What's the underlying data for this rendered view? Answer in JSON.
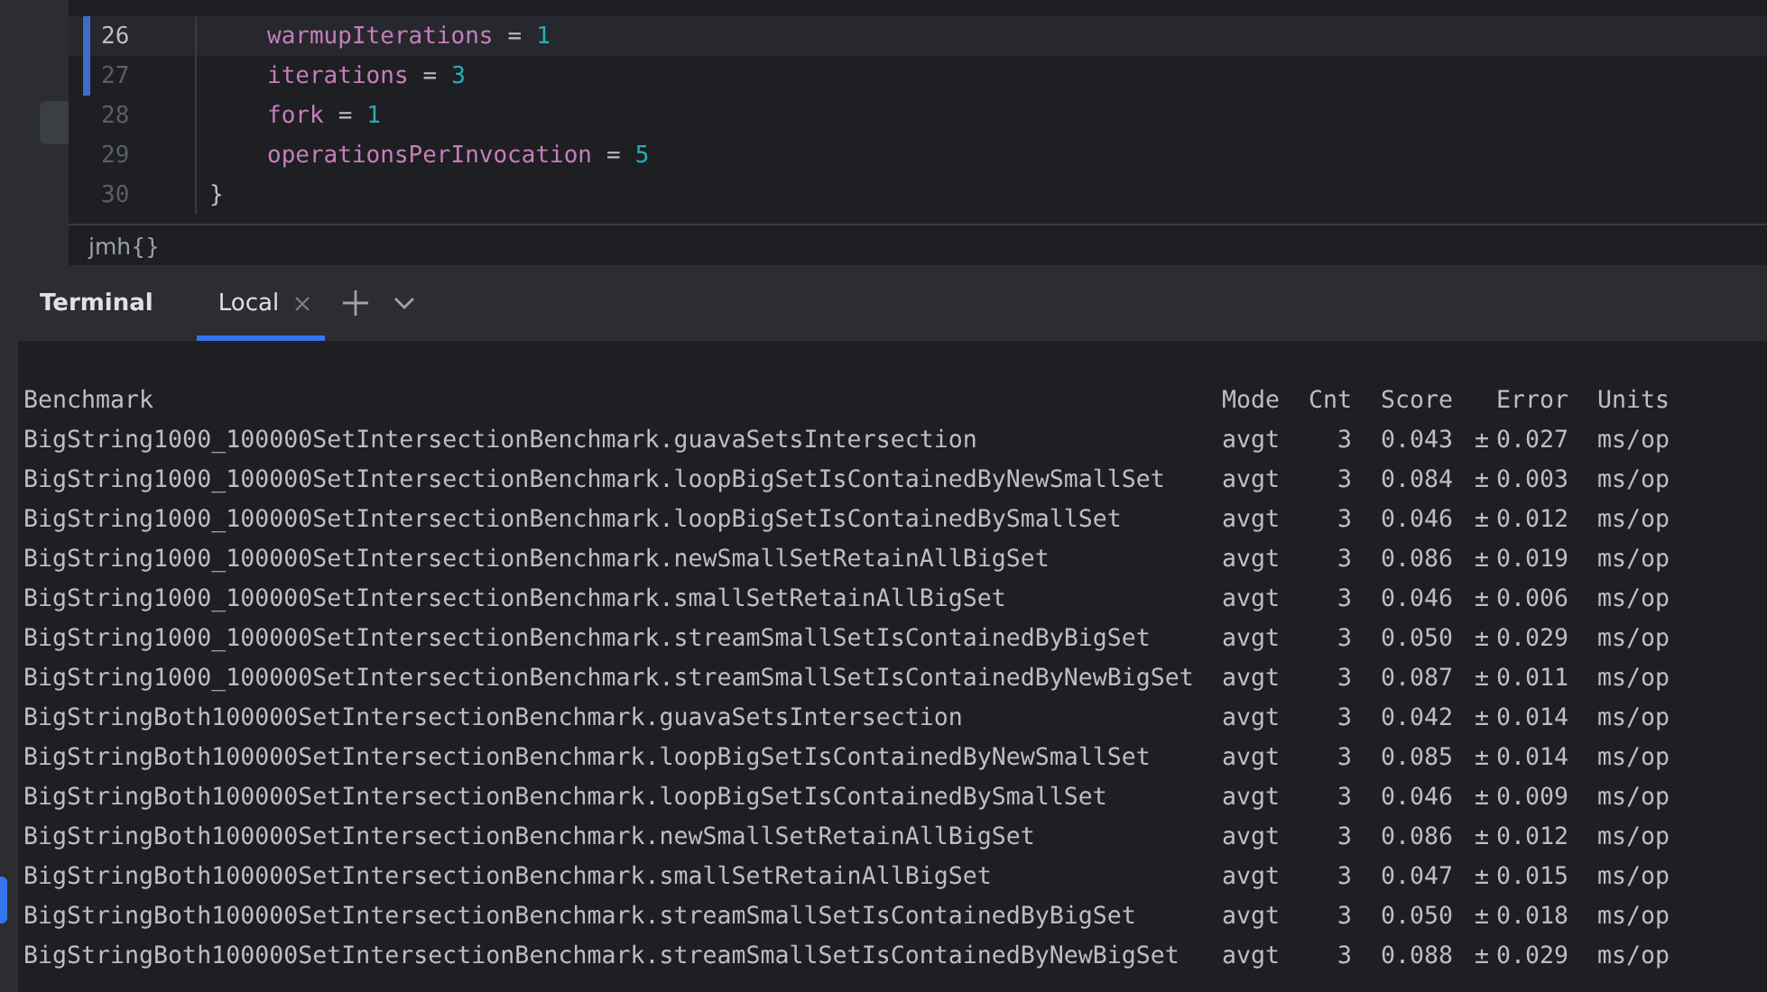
{
  "editor": {
    "lines": [
      {
        "number": "26",
        "current": true,
        "changed": true,
        "indented": true,
        "tokens": [
          {
            "kind": "property",
            "text": "warmupIterations"
          },
          {
            "kind": "operator",
            "text": "="
          },
          {
            "kind": "number",
            "text": "1"
          }
        ]
      },
      {
        "number": "27",
        "current": false,
        "changed": true,
        "indented": true,
        "tokens": [
          {
            "kind": "property",
            "text": "iterations"
          },
          {
            "kind": "operator",
            "text": "="
          },
          {
            "kind": "number",
            "text": "3"
          }
        ]
      },
      {
        "number": "28",
        "current": false,
        "changed": false,
        "indented": true,
        "tokens": [
          {
            "kind": "property",
            "text": "fork"
          },
          {
            "kind": "operator",
            "text": "="
          },
          {
            "kind": "number",
            "text": "1"
          }
        ]
      },
      {
        "number": "29",
        "current": false,
        "changed": false,
        "indented": true,
        "tokens": [
          {
            "kind": "property",
            "text": "operationsPerInvocation"
          },
          {
            "kind": "operator",
            "text": "="
          },
          {
            "kind": "number",
            "text": "5"
          }
        ]
      },
      {
        "number": "30",
        "current": false,
        "changed": false,
        "indented": false,
        "tokens": [
          {
            "kind": "brace",
            "text": "}"
          }
        ]
      }
    ],
    "breadcrumb": "jmh{}"
  },
  "terminal": {
    "title": "Terminal",
    "tabs": [
      {
        "label": "Local",
        "selected": true
      }
    ],
    "columns": [
      "Benchmark",
      "Mode",
      "Cnt",
      "Score",
      "Error",
      "Units"
    ],
    "rows": [
      {
        "benchmark": "BigString1000_100000SetIntersectionBenchmark.guavaSetsIntersection",
        "mode": "avgt",
        "cnt": "3",
        "score": "0.043",
        "sign": "±",
        "error": "0.027",
        "units": "ms/op"
      },
      {
        "benchmark": "BigString1000_100000SetIntersectionBenchmark.loopBigSetIsContainedByNewSmallSet",
        "mode": "avgt",
        "cnt": "3",
        "score": "0.084",
        "sign": "±",
        "error": "0.003",
        "units": "ms/op"
      },
      {
        "benchmark": "BigString1000_100000SetIntersectionBenchmark.loopBigSetIsContainedBySmallSet",
        "mode": "avgt",
        "cnt": "3",
        "score": "0.046",
        "sign": "±",
        "error": "0.012",
        "units": "ms/op"
      },
      {
        "benchmark": "BigString1000_100000SetIntersectionBenchmark.newSmallSetRetainAllBigSet",
        "mode": "avgt",
        "cnt": "3",
        "score": "0.086",
        "sign": "±",
        "error": "0.019",
        "units": "ms/op"
      },
      {
        "benchmark": "BigString1000_100000SetIntersectionBenchmark.smallSetRetainAllBigSet",
        "mode": "avgt",
        "cnt": "3",
        "score": "0.046",
        "sign": "±",
        "error": "0.006",
        "units": "ms/op"
      },
      {
        "benchmark": "BigString1000_100000SetIntersectionBenchmark.streamSmallSetIsContainedByBigSet",
        "mode": "avgt",
        "cnt": "3",
        "score": "0.050",
        "sign": "±",
        "error": "0.029",
        "units": "ms/op"
      },
      {
        "benchmark": "BigString1000_100000SetIntersectionBenchmark.streamSmallSetIsContainedByNewBigSet",
        "mode": "avgt",
        "cnt": "3",
        "score": "0.087",
        "sign": "±",
        "error": "0.011",
        "units": "ms/op"
      },
      {
        "benchmark": "BigStringBoth100000SetIntersectionBenchmark.guavaSetsIntersection",
        "mode": "avgt",
        "cnt": "3",
        "score": "0.042",
        "sign": "±",
        "error": "0.014",
        "units": "ms/op"
      },
      {
        "benchmark": "BigStringBoth100000SetIntersectionBenchmark.loopBigSetIsContainedByNewSmallSet",
        "mode": "avgt",
        "cnt": "3",
        "score": "0.085",
        "sign": "±",
        "error": "0.014",
        "units": "ms/op"
      },
      {
        "benchmark": "BigStringBoth100000SetIntersectionBenchmark.loopBigSetIsContainedBySmallSet",
        "mode": "avgt",
        "cnt": "3",
        "score": "0.046",
        "sign": "±",
        "error": "0.009",
        "units": "ms/op"
      },
      {
        "benchmark": "BigStringBoth100000SetIntersectionBenchmark.newSmallSetRetainAllBigSet",
        "mode": "avgt",
        "cnt": "3",
        "score": "0.086",
        "sign": "±",
        "error": "0.012",
        "units": "ms/op"
      },
      {
        "benchmark": "BigStringBoth100000SetIntersectionBenchmark.smallSetRetainAllBigSet",
        "mode": "avgt",
        "cnt": "3",
        "score": "0.047",
        "sign": "±",
        "error": "0.015",
        "units": "ms/op"
      },
      {
        "benchmark": "BigStringBoth100000SetIntersectionBenchmark.streamSmallSetIsContainedByBigSet",
        "mode": "avgt",
        "cnt": "3",
        "score": "0.050",
        "sign": "±",
        "error": "0.018",
        "units": "ms/op"
      },
      {
        "benchmark": "BigStringBoth100000SetIntersectionBenchmark.streamSmallSetIsContainedByNewBigSet",
        "mode": "avgt",
        "cnt": "3",
        "score": "0.088",
        "sign": "±",
        "error": "0.029",
        "units": "ms/op"
      }
    ]
  }
}
